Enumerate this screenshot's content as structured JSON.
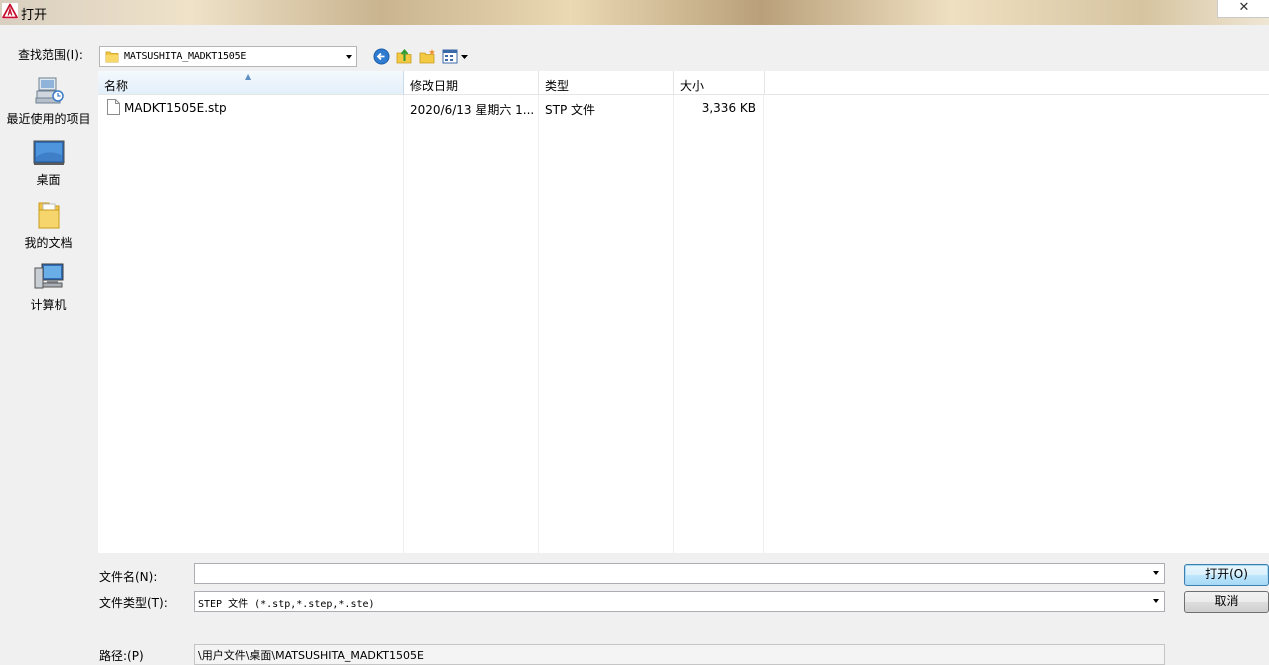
{
  "window": {
    "title": "打开",
    "close_label": "✕"
  },
  "toolbar": {
    "look_in_label": "查找范围(I):",
    "look_in_value": "MATSUSHITA_MADKT1505E"
  },
  "places": [
    {
      "label": "最近使用的项目"
    },
    {
      "label": "桌面"
    },
    {
      "label": "我的文档"
    },
    {
      "label": "计算机"
    }
  ],
  "file_list": {
    "columns": [
      "名称",
      "修改日期",
      "类型",
      "大小"
    ],
    "rows": [
      {
        "name": "MADKT1505E.stp",
        "modified": "2020/6/13 星期六 1...",
        "type": "STP 文件",
        "size": "3,336 KB"
      }
    ]
  },
  "filename": {
    "label": "文件名(N):",
    "value": ""
  },
  "filetype": {
    "label": "文件类型(T):",
    "value": "STEP 文件 (*.stp,*.step,*.ste)"
  },
  "path": {
    "label": "路径:(P)",
    "value": "\\用户文件\\桌面\\MATSUSHITA_MADKT1505E"
  },
  "buttons": {
    "open": "打开(O)",
    "cancel": "取消"
  }
}
